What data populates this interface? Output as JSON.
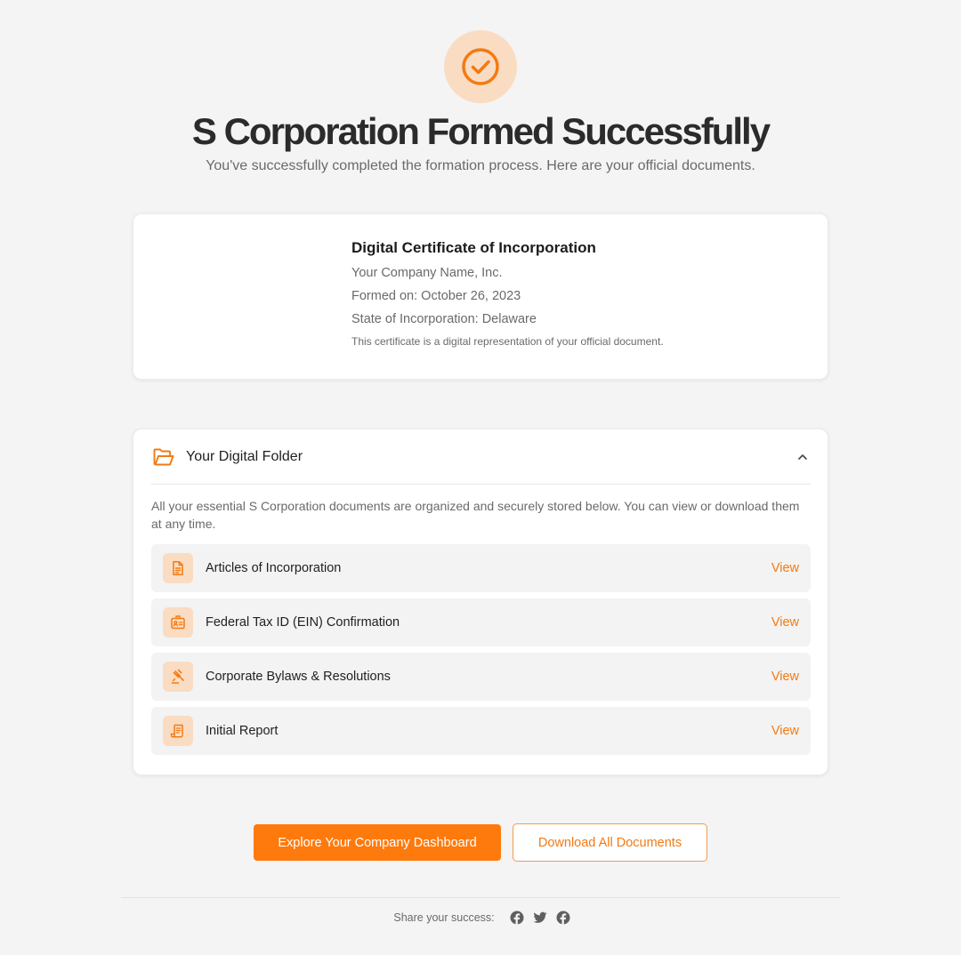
{
  "hero": {
    "icon": "check-circle-icon",
    "title": "S Corporation Formed Successfully",
    "subtitle": "You've successfully completed the formation process. Here are your official documents."
  },
  "certificate": {
    "title": "Digital Certificate of Incorporation",
    "company": "Your Company Name, Inc.",
    "formed_on": "Formed on: October 26, 2023",
    "state": "State of Incorporation: Delaware",
    "note": "This certificate is a digital representation of your official document."
  },
  "folder": {
    "icon": "folder-open-icon",
    "title": "Your Digital Folder",
    "expanded": true,
    "description": "All your essential S Corporation documents are organized and securely stored below. You can view or download them at any time.",
    "documents": [
      {
        "label": "Articles of Incorporation",
        "icon": "document-icon",
        "action": "View"
      },
      {
        "label": "Federal Tax ID (EIN) Confirmation",
        "icon": "id-card-icon",
        "action": "View"
      },
      {
        "label": "Corporate Bylaws & Resolutions",
        "icon": "gavel-icon",
        "action": "View"
      },
      {
        "label": "Initial Report",
        "icon": "report-scroll-icon",
        "action": "View"
      }
    ]
  },
  "actions": {
    "primary": "Explore Your Company Dashboard",
    "secondary": "Download All Documents"
  },
  "footer": {
    "share_label": "Share your success:",
    "social": [
      "facebook-icon",
      "twitter-icon",
      "facebook-icon"
    ]
  },
  "colors": {
    "accent": "#ff7a0d",
    "accent_soft": "#fadcc3",
    "background": "#f4f4f4"
  }
}
